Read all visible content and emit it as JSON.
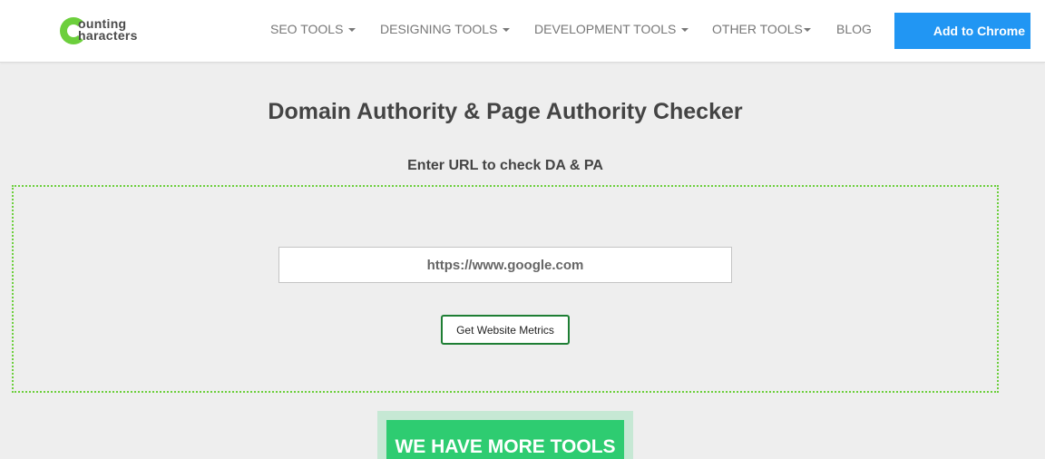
{
  "header": {
    "logo": {
      "line1": "ounting",
      "line2": "haracters",
      "alt": "Counting Characters"
    },
    "nav": [
      {
        "label": "SEO TOOLS",
        "dropdown": true
      },
      {
        "label": "DESIGNING TOOLS",
        "dropdown": true
      },
      {
        "label": "DEVELOPMENT TOOLS",
        "dropdown": true
      },
      {
        "label": "OTHER TOOLS",
        "dropdown": true
      },
      {
        "label": "BLOG",
        "dropdown": false
      }
    ],
    "cta_label": "Add to Chrome"
  },
  "main": {
    "title": "Domain Authority & Page Authority Checker",
    "subtitle": "Enter URL to check DA & PA",
    "url_input": {
      "value": "https://www.google.com"
    },
    "submit_label": "Get Website Metrics",
    "more_tools_label": "WE HAVE MORE TOOLS"
  },
  "colors": {
    "brand_green": "#6ccf3c",
    "cta_blue": "#2196f3",
    "more_tools_green": "#2ecc71",
    "button_border": "#1e7e34"
  }
}
